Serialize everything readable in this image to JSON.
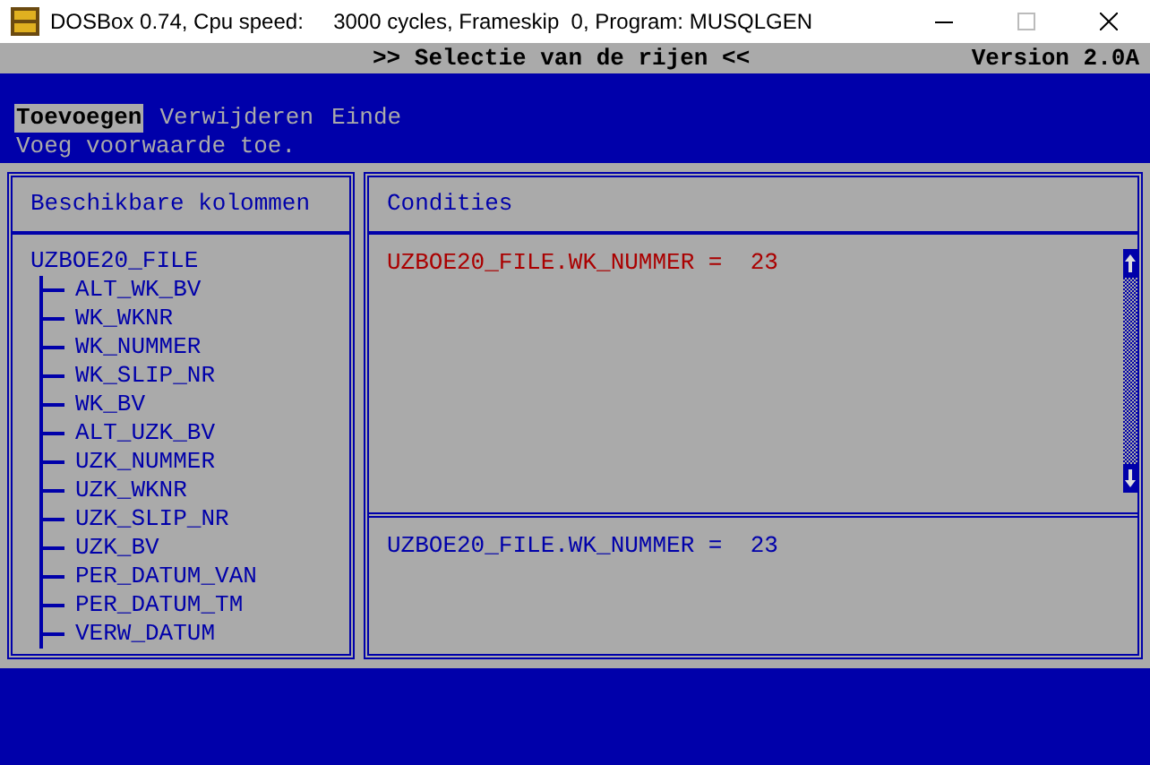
{
  "window": {
    "title": "DOSBox 0.74, Cpu speed:     3000 cycles, Frameskip  0, Program: MUSQLGEN"
  },
  "header": {
    "title": ">> Selectie van de rijen <<",
    "version": "Version 2.0A"
  },
  "menu": [
    {
      "label": "Toevoegen",
      "selected": true
    },
    {
      "label": "Verwijderen",
      "selected": false
    },
    {
      "label": "Einde",
      "selected": false
    }
  ],
  "hint": "Voeg voorwaarde toe.",
  "columns_panel": {
    "title": "Beschikbare kolommen",
    "tree": {
      "label": "UZBOE20_FILE",
      "children": [
        {
          "label": "ALT_WK_BV"
        },
        {
          "label": "WK_WKNR"
        },
        {
          "label": "WK_NUMMER"
        },
        {
          "label": "WK_SLIP_NR"
        },
        {
          "label": "WK_BV"
        },
        {
          "label": "ALT_UZK_BV"
        },
        {
          "label": "UZK_NUMMER"
        },
        {
          "label": "UZK_WKNR"
        },
        {
          "label": "UZK_SLIP_NR"
        },
        {
          "label": "UZK_BV"
        },
        {
          "label": "PER_DATUM_VAN"
        },
        {
          "label": "PER_DATUM_TM"
        },
        {
          "label": "VERW_DATUM"
        }
      ]
    }
  },
  "conditions_panel": {
    "title": "Condities",
    "conditions": [
      {
        "text": "UZBOE20_FILE.WK_NUMMER =  23",
        "selected": true
      }
    ],
    "detail": "UZBOE20_FILE.WK_NUMMER =  23"
  }
}
